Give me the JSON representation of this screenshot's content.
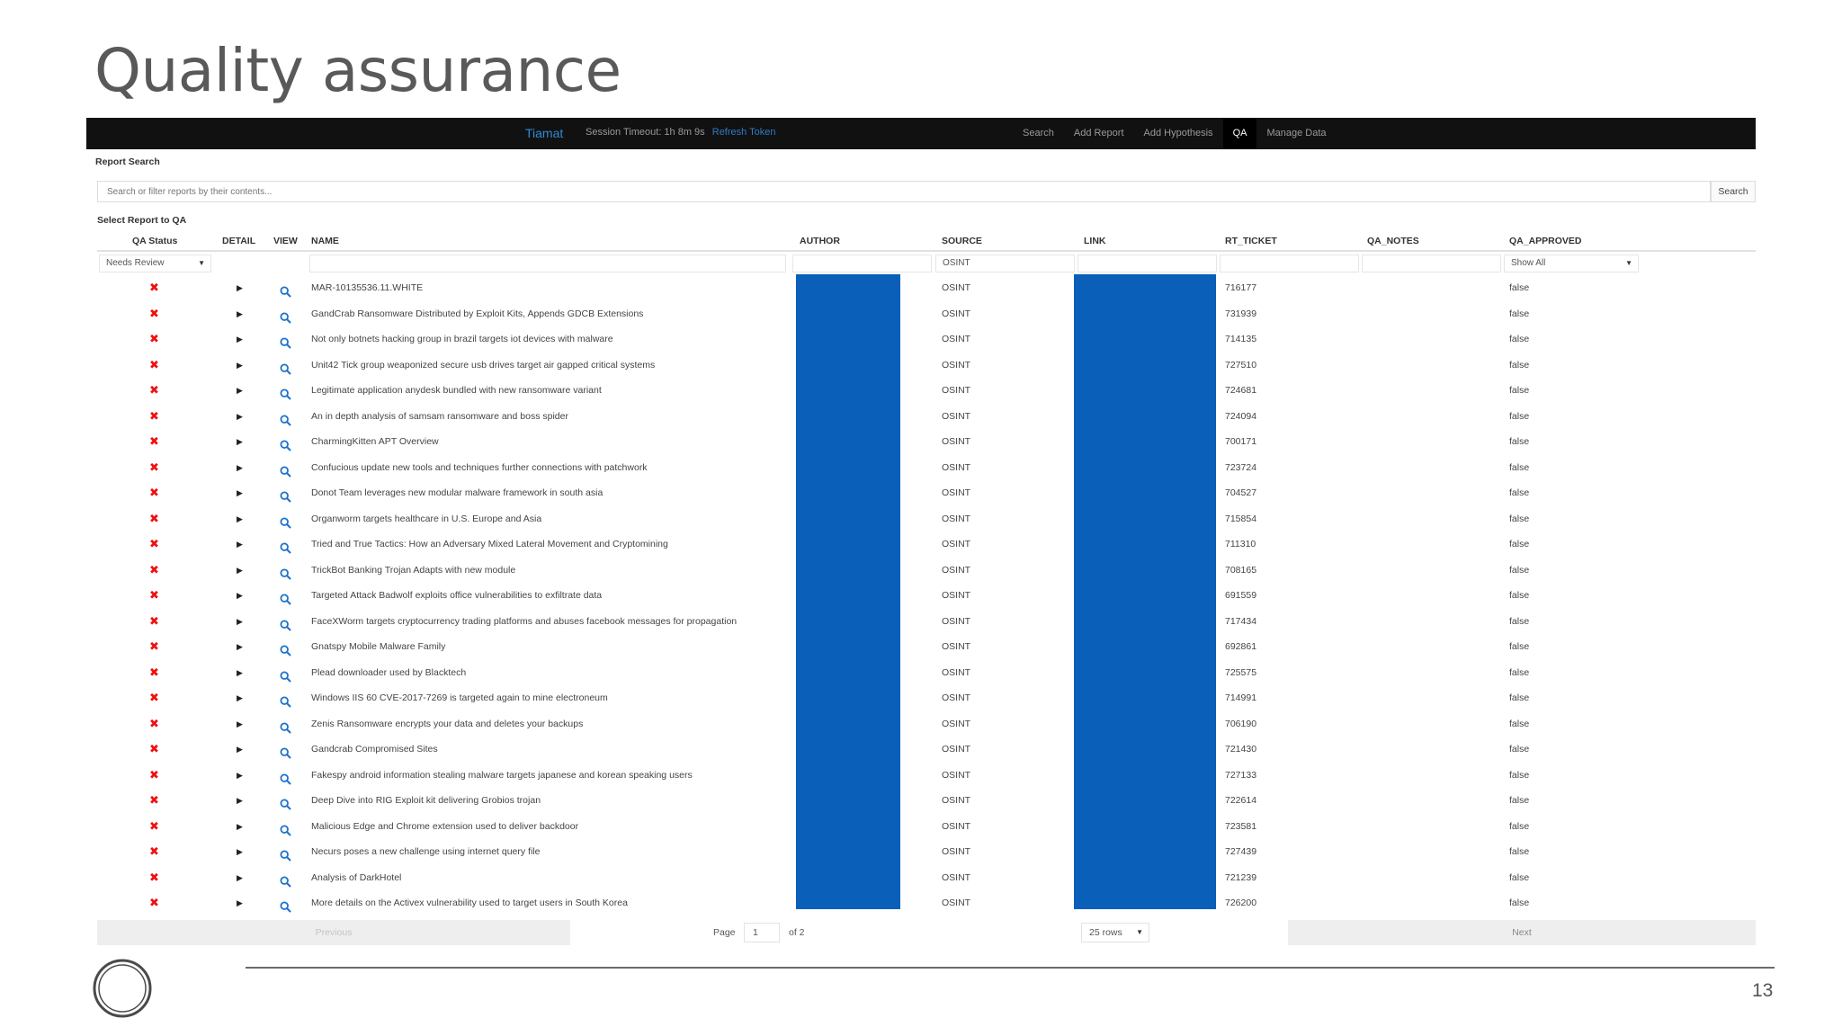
{
  "slide": {
    "title": "Quality assurance",
    "page_number": "13",
    "logo_name": "ge-monogram"
  },
  "navbar": {
    "brand": "Tiamat",
    "session_timeout": "Session Timeout: 1h 8m 9s",
    "refresh_label": "Refresh Token",
    "links": [
      {
        "label": "Search",
        "active": false
      },
      {
        "label": "Add Report",
        "active": false
      },
      {
        "label": "Add Hypothesis",
        "active": false
      },
      {
        "label": "QA",
        "active": true
      },
      {
        "label": "Manage Data",
        "active": false
      }
    ]
  },
  "report_search": {
    "label": "Report Search",
    "placeholder": "Search or filter reports by their contents...",
    "button_label": "Search"
  },
  "table": {
    "title": "Select Report to QA",
    "columns": [
      "QA Status",
      "DETAIL",
      "VIEW",
      "NAME",
      "AUTHOR",
      "SOURCE",
      "LINK",
      "RT_TICKET",
      "QA_NOTES",
      "QA_APPROVED"
    ],
    "filters": {
      "qa_status": "Needs Review",
      "source": "OSINT",
      "qa_approved": "Show All"
    },
    "redaction_color": "#0a5fb8",
    "status_color": "#e11111",
    "icons": {
      "status": "x-icon",
      "detail": "caret-right-icon",
      "view": "magnifier-icon"
    },
    "rows": [
      {
        "name": "MAR-10135536.11.WHITE",
        "source": "OSINT",
        "rt_ticket": "716177",
        "qa_approved": "false"
      },
      {
        "name": "GandCrab Ransomware Distributed by Exploit Kits, Appends GDCB Extensions",
        "source": "OSINT",
        "rt_ticket": "731939",
        "qa_approved": "false"
      },
      {
        "name": "Not only botnets hacking group in brazil targets iot devices with malware",
        "source": "OSINT",
        "rt_ticket": "714135",
        "qa_approved": "false"
      },
      {
        "name": "Unit42 Tick group weaponized secure usb drives target air gapped critical systems",
        "source": "OSINT",
        "rt_ticket": "727510",
        "qa_approved": "false"
      },
      {
        "name": "Legitimate application anydesk bundled with new ransomware variant",
        "source": "OSINT",
        "rt_ticket": "724681",
        "qa_approved": "false"
      },
      {
        "name": "An in depth analysis of samsam ransomware and boss spider",
        "source": "OSINT",
        "rt_ticket": "724094",
        "qa_approved": "false"
      },
      {
        "name": "CharmingKitten APT Overview",
        "source": "OSINT",
        "rt_ticket": "700171",
        "qa_approved": "false"
      },
      {
        "name": "Confucious update new tools and techniques further connections with patchwork",
        "source": "OSINT",
        "rt_ticket": "723724",
        "qa_approved": "false"
      },
      {
        "name": "Donot Team leverages new modular malware framework in south asia",
        "source": "OSINT",
        "rt_ticket": "704527",
        "qa_approved": "false"
      },
      {
        "name": "Organworm targets healthcare in U.S. Europe and Asia",
        "source": "OSINT",
        "rt_ticket": "715854",
        "qa_approved": "false"
      },
      {
        "name": "Tried and True Tactics: How an Adversary Mixed Lateral Movement and Cryptomining",
        "source": "OSINT",
        "rt_ticket": "711310",
        "qa_approved": "false"
      },
      {
        "name": "TrickBot Banking Trojan Adapts with new module",
        "source": "OSINT",
        "rt_ticket": "708165",
        "qa_approved": "false"
      },
      {
        "name": "Targeted Attack Badwolf exploits office vulnerabilities to exfiltrate data",
        "source": "OSINT",
        "rt_ticket": "691559",
        "qa_approved": "false"
      },
      {
        "name": "FaceXWorm targets cryptocurrency trading platforms and abuses facebook messages for propagation",
        "source": "OSINT",
        "rt_ticket": "717434",
        "qa_approved": "false"
      },
      {
        "name": "Gnatspy Mobile Malware Family",
        "source": "OSINT",
        "rt_ticket": "692861",
        "qa_approved": "false"
      },
      {
        "name": "Plead downloader used by Blacktech",
        "source": "OSINT",
        "rt_ticket": "725575",
        "qa_approved": "false"
      },
      {
        "name": "Windows IIS 60 CVE-2017-7269 is targeted again to mine electroneum",
        "source": "OSINT",
        "rt_ticket": "714991",
        "qa_approved": "false"
      },
      {
        "name": "Zenis Ransomware encrypts your data and deletes your backups",
        "source": "OSINT",
        "rt_ticket": "706190",
        "qa_approved": "false"
      },
      {
        "name": "Gandcrab Compromised Sites",
        "source": "OSINT",
        "rt_ticket": "721430",
        "qa_approved": "false"
      },
      {
        "name": "Fakespy android information stealing malware targets japanese and korean speaking users",
        "source": "OSINT",
        "rt_ticket": "727133",
        "qa_approved": "false"
      },
      {
        "name": "Deep Dive into RIG Exploit kit delivering Grobios trojan",
        "source": "OSINT",
        "rt_ticket": "722614",
        "qa_approved": "false"
      },
      {
        "name": "Malicious Edge and Chrome extension used to deliver backdoor",
        "source": "OSINT",
        "rt_ticket": "723581",
        "qa_approved": "false"
      },
      {
        "name": "Necurs poses a new challenge using internet query file",
        "source": "OSINT",
        "rt_ticket": "727439",
        "qa_approved": "false"
      },
      {
        "name": "Analysis of DarkHotel",
        "source": "OSINT",
        "rt_ticket": "721239",
        "qa_approved": "false"
      },
      {
        "name": "More details on the Activex vulnerability used to target users in South Korea",
        "source": "OSINT",
        "rt_ticket": "726200",
        "qa_approved": "false"
      }
    ]
  },
  "pagination": {
    "previous_label": "Previous",
    "page_label": "Page",
    "page_value": "1",
    "of_label": "of 2",
    "rows_option": "25 rows",
    "next_label": "Next"
  }
}
